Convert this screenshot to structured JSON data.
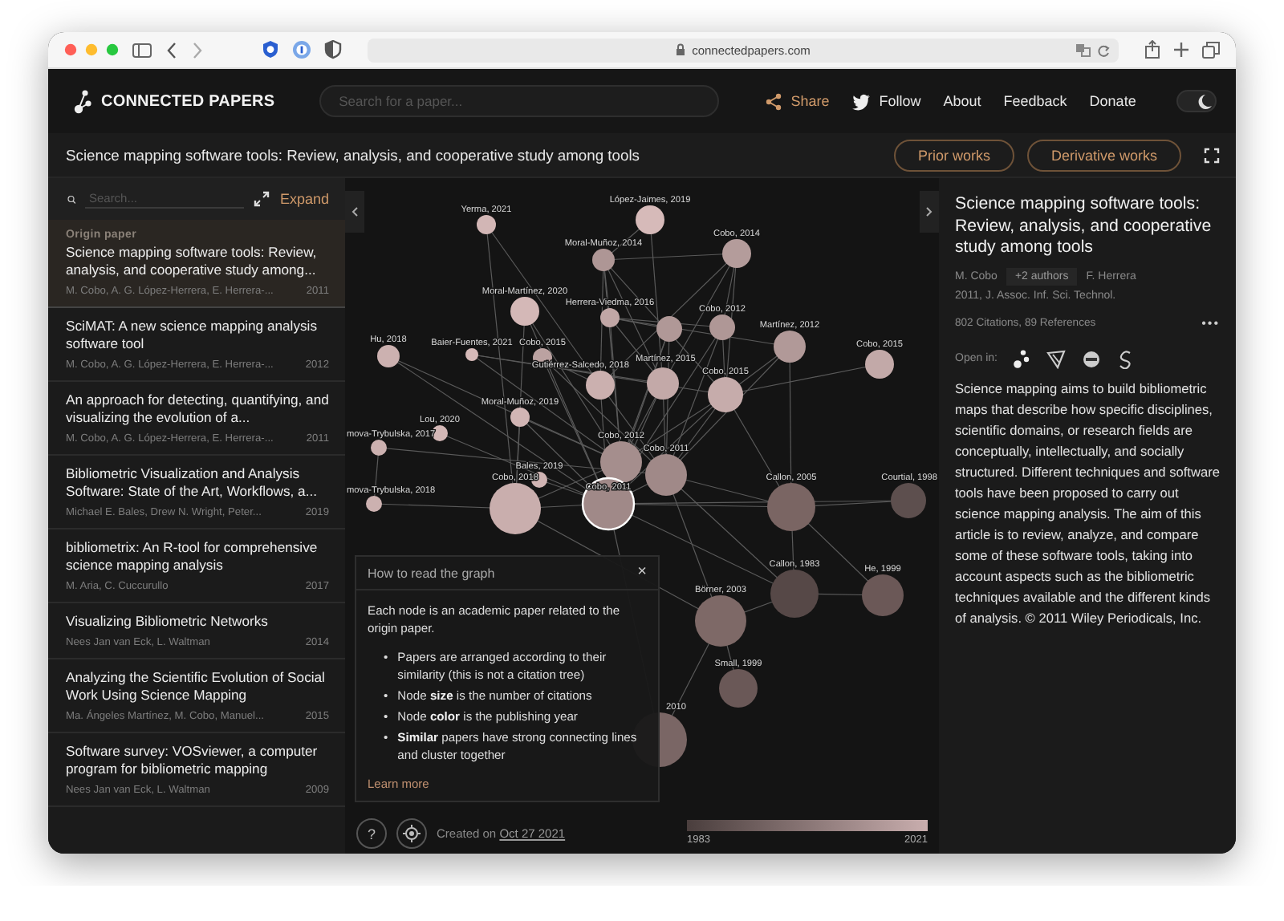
{
  "browser": {
    "url": "connectedpapers.com"
  },
  "header": {
    "logo": "CONNECTED PAPERS",
    "search_placeholder": "Search for a paper...",
    "nav": [
      {
        "label": "Share",
        "kind": "share"
      },
      {
        "label": "Follow",
        "kind": "twitter"
      },
      {
        "label": "About",
        "kind": "plain"
      },
      {
        "label": "Feedback",
        "kind": "plain"
      },
      {
        "label": "Donate",
        "kind": "plain"
      }
    ],
    "dark_mode": true
  },
  "title_bar": {
    "title": "Science mapping software tools: Review, analysis, and cooperative study among tools",
    "buttons": [
      "Prior works",
      "Derivative works"
    ]
  },
  "sidebar": {
    "search_placeholder": "Search...",
    "expand": "Expand",
    "papers": [
      {
        "tag": "Origin paper",
        "title": "Science mapping software tools: Review, analysis, and cooperative study among...",
        "authors": "M. Cobo, A. G. López-Herrera, E. Herrera-...",
        "year": "2011",
        "selected": true
      },
      {
        "title": "SciMAT: A new science mapping analysis software tool",
        "authors": "M. Cobo, A. G. López-Herrera, E. Herrera-...",
        "year": "2012",
        "selected": false
      },
      {
        "title": "An approach for detecting, quantifying, and visualizing the evolution of a...",
        "authors": "M. Cobo, A. G. López-Herrera, E. Herrera-...",
        "year": "2011",
        "selected": false
      },
      {
        "title": "Bibliometric Visualization and Analysis Software: State of the Art, Workflows, a...",
        "authors": "Michael E. Bales, Drew N. Wright, Peter...",
        "year": "2019",
        "selected": false
      },
      {
        "title": "bibliometrix: An R-tool for comprehensive science mapping analysis",
        "authors": "M. Aria, C. Cuccurullo",
        "year": "2017",
        "selected": false
      },
      {
        "title": "Visualizing Bibliometric Networks",
        "authors": "Nees Jan van Eck, L. Waltman",
        "year": "2014",
        "selected": false
      },
      {
        "title": "Analyzing the Scientific Evolution of Social Work Using Science Mapping",
        "authors": "Ma. Ángeles Martínez, M. Cobo, Manuel...",
        "year": "2015",
        "selected": false
      },
      {
        "title": "Software survey: VOSviewer, a computer program for bibliometric mapping",
        "authors": "Nees Jan van Eck, L. Waltman",
        "year": "2009",
        "selected": false
      }
    ]
  },
  "graph": {
    "nodes": [
      {
        "label": "Yerma, 2021",
        "color": "#d2b6b5",
        "origin": false
      },
      {
        "label": "López-Jaimes, 2019",
        "color": "#d6bab9",
        "origin": false
      },
      {
        "label": "Moral-Muñoz, 2014",
        "color": "#ae9695",
        "origin": false
      },
      {
        "label": "Cobo, 2014",
        "color": "#b49c9b",
        "origin": false
      },
      {
        "label": "Moral-Martínez, 2020",
        "color": "#d4b8b7",
        "origin": false
      },
      {
        "label": "Herrera-Viedma, 2016",
        "color": "#c1a7a6",
        "origin": false
      },
      {
        "color": "#b09897",
        "origin": false
      },
      {
        "label": "Cobo, 2012",
        "color": "#af9796",
        "origin": false
      },
      {
        "label": "Martínez, 2012",
        "color": "#b19998",
        "origin": false
      },
      {
        "label": "Cobo, 2015",
        "color": "#c2a9a8",
        "origin": false
      },
      {
        "label": "Hu, 2018",
        "color": "#ccb1b0",
        "origin": false
      },
      {
        "label": "Baier-Fuentes, 2021",
        "color": "#d6bab9",
        "origin": false
      },
      {
        "label": "Cobo, 2015",
        "color": "#bba2a1",
        "origin": false
      },
      {
        "label": "Gutiérrez-Salcedo, 2018",
        "color": "#cbb0af",
        "origin": false
      },
      {
        "label": "Martínez, 2015",
        "color": "#c3a9a8",
        "origin": false
      },
      {
        "label": "Cobo, 2015",
        "color": "#c6acab",
        "origin": false
      },
      {
        "label": "Moral-Muñoz, 2019",
        "color": "#d1b5b4",
        "origin": false
      },
      {
        "label": "Lou, 2020",
        "color": "#d3b7b6",
        "origin": false
      },
      {
        "label": "mova-Trybulska, 2017",
        "color": "#ccb1b0",
        "origin": false
      },
      {
        "label": "Cobo, 2012",
        "color": "#a58e8d",
        "origin": false
      },
      {
        "label": "Cobo, 2011",
        "color": "#a08988",
        "origin": false
      },
      {
        "label": "Bales, 2019",
        "color": "#d0b4b3",
        "origin": false
      },
      {
        "label": "Cobo, 2018",
        "color": "#c9aead",
        "origin": false
      },
      {
        "label": "Cobo, 2011",
        "color": "#a08988",
        "origin": true
      },
      {
        "label": "mova-Trybulska, 2018",
        "color": "#ccb1b0",
        "origin": false
      },
      {
        "label": "Callon, 2005",
        "color": "#7a6563",
        "origin": false
      },
      {
        "label": "Courtial, 1998",
        "color": "#5d4f4e",
        "origin": false
      },
      {
        "label": "Callon, 1983",
        "color": "#564847",
        "origin": false
      },
      {
        "label": "He, 1999",
        "color": "#6b5857",
        "origin": false
      },
      {
        "label": "Börner, 2003",
        "color": "#7e6967",
        "origin": false
      },
      {
        "label": "Small, 1999",
        "color": "#6a5857",
        "origin": false
      },
      {
        "label": "2010",
        "color": "#7a6665",
        "origin": false
      }
    ],
    "legend": {
      "start": "1983",
      "end": "2021"
    },
    "help": {
      "title": "How to read the graph",
      "close": "×",
      "intro": "Each node is an academic paper related to the origin paper.",
      "marker": "•",
      "bullets": [
        "Papers are arranged according to their similarity (this is not a citation tree)",
        "Node **size** is the number of citations",
        "Node **color** is the publishing year",
        "**Similar** papers have strong connecting lines and cluster together"
      ],
      "link": "Learn more"
    },
    "help_button": "?",
    "created_prefix": "Created on",
    "created_date": "Oct 27 2021"
  },
  "detail": {
    "title": "Science mapping software tools: Review, analysis, and cooperative study among tools",
    "first_author": "M. Cobo",
    "more_authors": "+2 authors",
    "last_author": "F. Herrera",
    "venue": "2011, J. Assoc. Inf. Sci. Technol.",
    "counts": "802 Citations, 89 References",
    "more": "•••",
    "open_in": "Open in:",
    "abstract": "Science mapping aims to build bibliometric maps that describe how specific disciplines, scientific domains, or research fields are conceptually, intellectually, and socially structured. Different techniques and software tools have been proposed to carry out science mapping analysis. The aim of this article is to review, analyze, and compare some of these software tools, taking into account aspects such as the bibliometric techniques available and the different kinds of analysis. © 2011 Wiley Periodicals, Inc."
  }
}
